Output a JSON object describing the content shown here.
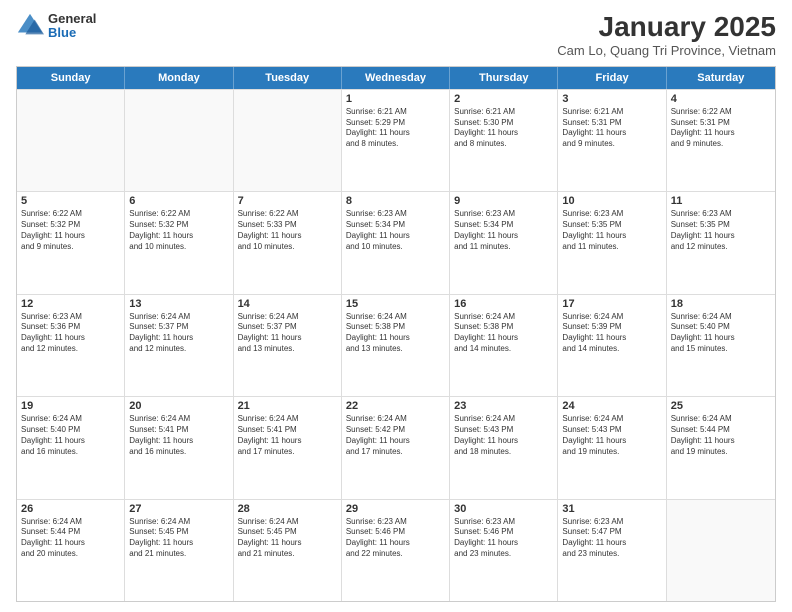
{
  "header": {
    "logo_general": "General",
    "logo_blue": "Blue",
    "month_title": "January 2025",
    "subtitle": "Cam Lo, Quang Tri Province, Vietnam"
  },
  "weekdays": [
    "Sunday",
    "Monday",
    "Tuesday",
    "Wednesday",
    "Thursday",
    "Friday",
    "Saturday"
  ],
  "rows": [
    [
      {
        "day": "",
        "text": "",
        "empty": true
      },
      {
        "day": "",
        "text": "",
        "empty": true
      },
      {
        "day": "",
        "text": "",
        "empty": true
      },
      {
        "day": "1",
        "text": "Sunrise: 6:21 AM\nSunset: 5:29 PM\nDaylight: 11 hours\nand 8 minutes."
      },
      {
        "day": "2",
        "text": "Sunrise: 6:21 AM\nSunset: 5:30 PM\nDaylight: 11 hours\nand 8 minutes."
      },
      {
        "day": "3",
        "text": "Sunrise: 6:21 AM\nSunset: 5:31 PM\nDaylight: 11 hours\nand 9 minutes."
      },
      {
        "day": "4",
        "text": "Sunrise: 6:22 AM\nSunset: 5:31 PM\nDaylight: 11 hours\nand 9 minutes."
      }
    ],
    [
      {
        "day": "5",
        "text": "Sunrise: 6:22 AM\nSunset: 5:32 PM\nDaylight: 11 hours\nand 9 minutes."
      },
      {
        "day": "6",
        "text": "Sunrise: 6:22 AM\nSunset: 5:32 PM\nDaylight: 11 hours\nand 10 minutes."
      },
      {
        "day": "7",
        "text": "Sunrise: 6:22 AM\nSunset: 5:33 PM\nDaylight: 11 hours\nand 10 minutes."
      },
      {
        "day": "8",
        "text": "Sunrise: 6:23 AM\nSunset: 5:34 PM\nDaylight: 11 hours\nand 10 minutes."
      },
      {
        "day": "9",
        "text": "Sunrise: 6:23 AM\nSunset: 5:34 PM\nDaylight: 11 hours\nand 11 minutes."
      },
      {
        "day": "10",
        "text": "Sunrise: 6:23 AM\nSunset: 5:35 PM\nDaylight: 11 hours\nand 11 minutes."
      },
      {
        "day": "11",
        "text": "Sunrise: 6:23 AM\nSunset: 5:35 PM\nDaylight: 11 hours\nand 12 minutes."
      }
    ],
    [
      {
        "day": "12",
        "text": "Sunrise: 6:23 AM\nSunset: 5:36 PM\nDaylight: 11 hours\nand 12 minutes."
      },
      {
        "day": "13",
        "text": "Sunrise: 6:24 AM\nSunset: 5:37 PM\nDaylight: 11 hours\nand 12 minutes."
      },
      {
        "day": "14",
        "text": "Sunrise: 6:24 AM\nSunset: 5:37 PM\nDaylight: 11 hours\nand 13 minutes."
      },
      {
        "day": "15",
        "text": "Sunrise: 6:24 AM\nSunset: 5:38 PM\nDaylight: 11 hours\nand 13 minutes."
      },
      {
        "day": "16",
        "text": "Sunrise: 6:24 AM\nSunset: 5:38 PM\nDaylight: 11 hours\nand 14 minutes."
      },
      {
        "day": "17",
        "text": "Sunrise: 6:24 AM\nSunset: 5:39 PM\nDaylight: 11 hours\nand 14 minutes."
      },
      {
        "day": "18",
        "text": "Sunrise: 6:24 AM\nSunset: 5:40 PM\nDaylight: 11 hours\nand 15 minutes."
      }
    ],
    [
      {
        "day": "19",
        "text": "Sunrise: 6:24 AM\nSunset: 5:40 PM\nDaylight: 11 hours\nand 16 minutes."
      },
      {
        "day": "20",
        "text": "Sunrise: 6:24 AM\nSunset: 5:41 PM\nDaylight: 11 hours\nand 16 minutes."
      },
      {
        "day": "21",
        "text": "Sunrise: 6:24 AM\nSunset: 5:41 PM\nDaylight: 11 hours\nand 17 minutes."
      },
      {
        "day": "22",
        "text": "Sunrise: 6:24 AM\nSunset: 5:42 PM\nDaylight: 11 hours\nand 17 minutes."
      },
      {
        "day": "23",
        "text": "Sunrise: 6:24 AM\nSunset: 5:43 PM\nDaylight: 11 hours\nand 18 minutes."
      },
      {
        "day": "24",
        "text": "Sunrise: 6:24 AM\nSunset: 5:43 PM\nDaylight: 11 hours\nand 19 minutes."
      },
      {
        "day": "25",
        "text": "Sunrise: 6:24 AM\nSunset: 5:44 PM\nDaylight: 11 hours\nand 19 minutes."
      }
    ],
    [
      {
        "day": "26",
        "text": "Sunrise: 6:24 AM\nSunset: 5:44 PM\nDaylight: 11 hours\nand 20 minutes."
      },
      {
        "day": "27",
        "text": "Sunrise: 6:24 AM\nSunset: 5:45 PM\nDaylight: 11 hours\nand 21 minutes."
      },
      {
        "day": "28",
        "text": "Sunrise: 6:24 AM\nSunset: 5:45 PM\nDaylight: 11 hours\nand 21 minutes."
      },
      {
        "day": "29",
        "text": "Sunrise: 6:23 AM\nSunset: 5:46 PM\nDaylight: 11 hours\nand 22 minutes."
      },
      {
        "day": "30",
        "text": "Sunrise: 6:23 AM\nSunset: 5:46 PM\nDaylight: 11 hours\nand 23 minutes."
      },
      {
        "day": "31",
        "text": "Sunrise: 6:23 AM\nSunset: 5:47 PM\nDaylight: 11 hours\nand 23 minutes."
      },
      {
        "day": "",
        "text": "",
        "empty": true
      }
    ]
  ]
}
